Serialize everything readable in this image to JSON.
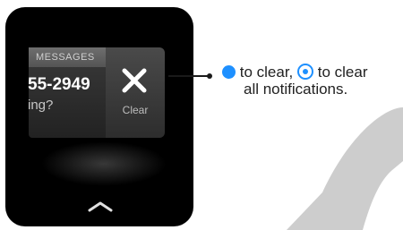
{
  "notification": {
    "app_name": "MESSAGES",
    "number": "55-2949",
    "preview": "ing?"
  },
  "clear_button": {
    "label": "Clear"
  },
  "callout": {
    "part1": "to clear,",
    "part2": "to clear",
    "part3": "all notifications."
  },
  "colors": {
    "accent": "#1e90ff",
    "swoosh": "#cccccc"
  },
  "icons": [
    "close-x-icon",
    "tap-icon",
    "force-press-icon",
    "chevron-up-icon"
  ]
}
